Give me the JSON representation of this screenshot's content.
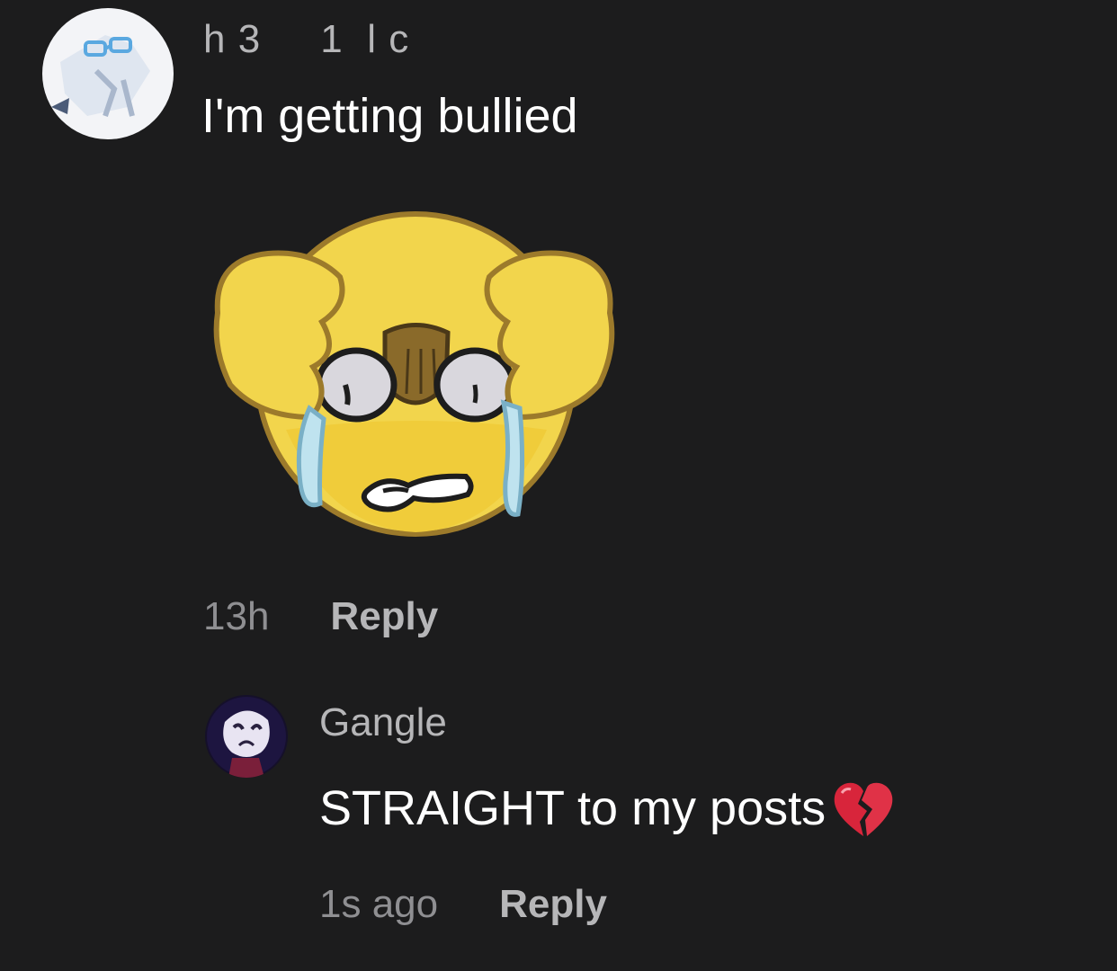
{
  "comment": {
    "username": "h 3     1  l c",
    "text": "I'm getting bullied",
    "timestamp": "13h",
    "reply_label": "Reply",
    "sticker": "crying-emoji-sticker"
  },
  "reply": {
    "username": "Gangle",
    "text": "STRAIGHT to my posts",
    "emoji": "broken-heart-icon",
    "timestamp": "1s ago",
    "reply_label": "Reply"
  },
  "colors": {
    "background": "#1c1c1d",
    "text": "#ffffff",
    "muted": "#8f8f92",
    "username": "#b6b6b8",
    "sticker_yellow": "#f2d54c",
    "heart_red": "#d8253b"
  }
}
